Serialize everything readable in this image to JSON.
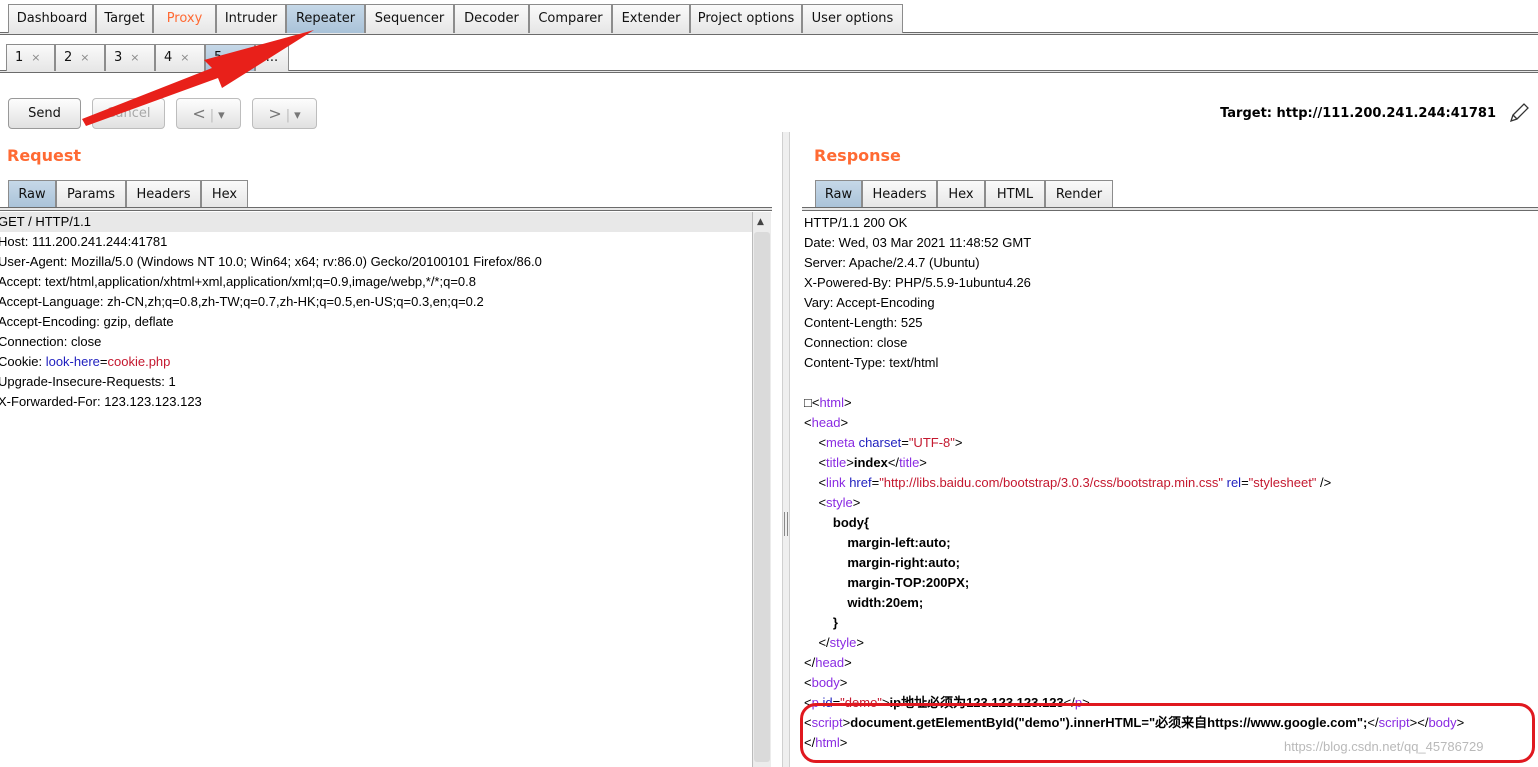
{
  "top_tabs": [
    "Dashboard",
    "Target",
    "Proxy",
    "Intruder",
    "Repeater",
    "Sequencer",
    "Decoder",
    "Comparer",
    "Extender",
    "Project options",
    "User options"
  ],
  "active_top_tab": "Repeater",
  "sub_tabs": [
    "1",
    "2",
    "3",
    "4",
    "5"
  ],
  "sub_tab_more": "...",
  "close_glyph": "×",
  "toolbar": {
    "send": "Send",
    "cancel": "Cancel",
    "back": "<",
    "forward": ">",
    "dropdown": "▾",
    "target": "Target: http://111.200.241.244:41781"
  },
  "request": {
    "title": "Request",
    "tabs": [
      "Raw",
      "Params",
      "Headers",
      "Hex"
    ],
    "lines": [
      "GET / HTTP/1.1",
      "Host: 111.200.241.244:41781",
      "User-Agent: Mozilla/5.0 (Windows NT 10.0; Win64; x64; rv:86.0) Gecko/20100101 Firefox/86.0",
      "Accept: text/html,application/xhtml+xml,application/xml;q=0.9,image/webp,*/*;q=0.8",
      "Accept-Language: zh-CN,zh;q=0.8,zh-TW;q=0.7,zh-HK;q=0.5,en-US;q=0.3,en;q=0.2",
      "Accept-Encoding: gzip, deflate",
      "Connection: close"
    ],
    "cookie_prefix": "Cookie: ",
    "cookie_key": "look-here",
    "cookie_eq": "=",
    "cookie_value": "cookie.php",
    "lines_after": [
      "Upgrade-Insecure-Requests: 1",
      "X-Forwarded-For: 123.123.123.123"
    ]
  },
  "response": {
    "title": "Response",
    "tabs": [
      "Raw",
      "Headers",
      "Hex",
      "HTML",
      "Render"
    ],
    "headers": [
      "HTTP/1.1 200 OK",
      "Date: Wed, 03 Mar 2021 11:48:52 GMT",
      "Server: Apache/2.4.7 (Ubuntu)",
      "X-Powered-By: PHP/5.5.9-1ubuntu4.26",
      "Vary: Accept-Encoding",
      "Content-Length: 525",
      "Connection: close",
      "Content-Type: text/html"
    ],
    "bom": "□",
    "html_open": "html",
    "head_open": "head",
    "meta": "meta",
    "charset_attr": "charset",
    "charset_val": "\"UTF-8\"",
    "title_tag": "title",
    "title_text": "index",
    "link_tag": "link",
    "href_attr": "href",
    "href_val": "\"http://libs.baidu.com/bootstrap/3.0.3/css/bootstrap.min.css\"",
    "rel_attr": "rel",
    "rel_val": "\"stylesheet\"",
    "style_tag": "style",
    "css": [
      "body{",
      "margin-left:auto;",
      "margin-right:auto;",
      "margin-TOP:200PX;",
      "width:20em;",
      "}"
    ],
    "body_tag": "body",
    "p_tag": "p",
    "id_attr": "id",
    "id_val": "\"demo\"",
    "p_text": "ip地址必须为123.123.123.123",
    "script_tag": "script",
    "script_text": "document.getElementById(\"demo\").innerHTML=\"必须来自https://www.google.com\";"
  },
  "watermark": "https://blog.csdn.net/qq_45786729",
  "colors": {
    "accent": "#ff6a33",
    "highlight": "#e0181f",
    "arrow": "#e8201a"
  }
}
